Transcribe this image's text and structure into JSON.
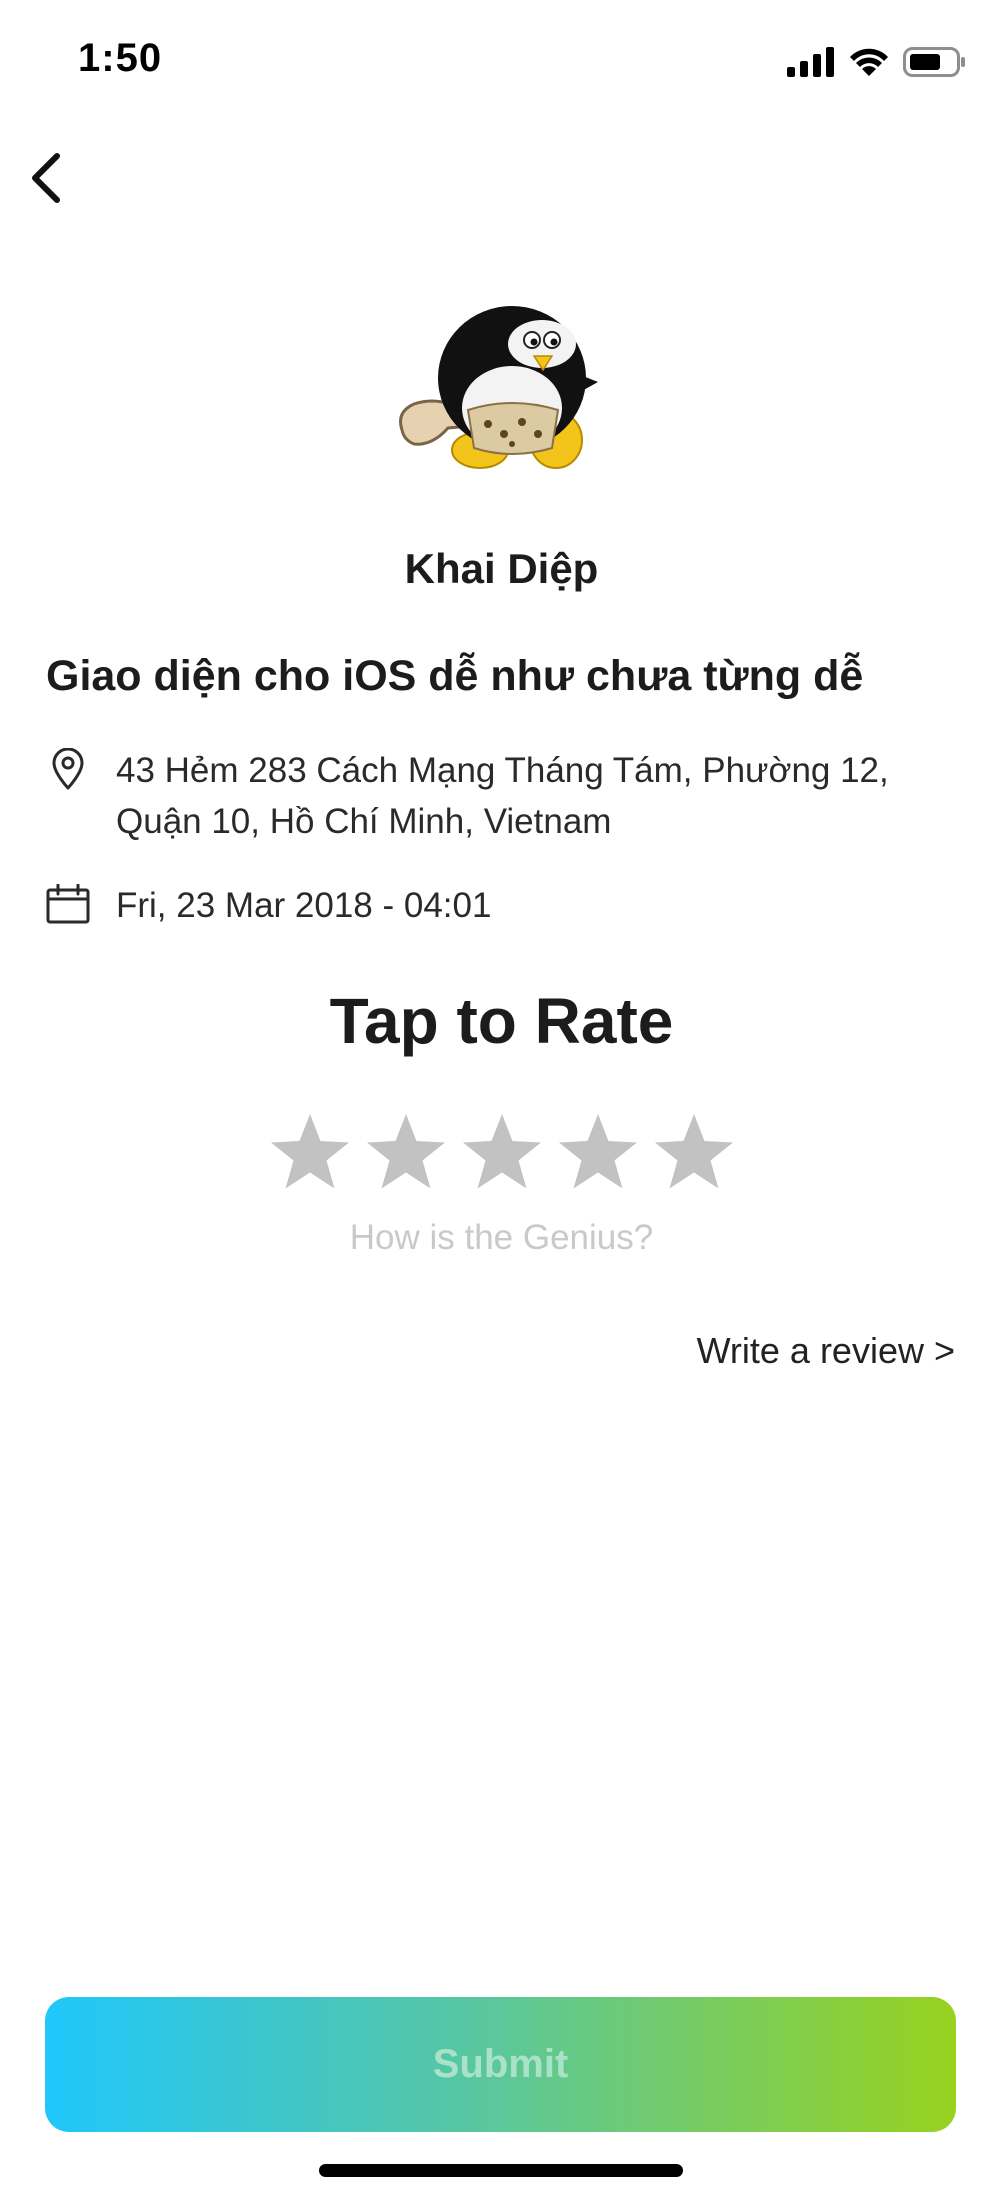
{
  "status_bar": {
    "time": "1:50",
    "icons": [
      "cellular-signal-icon",
      "wifi-icon",
      "battery-icon"
    ]
  },
  "nav": {
    "back_icon": "chevron-left-icon"
  },
  "profile": {
    "name": "Khai Diệp",
    "avatar": "penguin-avatar"
  },
  "event": {
    "title": "Giao diện cho iOS dễ như chưa từng dễ",
    "address_line1": "43 Hẻm 283 Cách Mạng Tháng Tám, Phường 12,",
    "address_line2": "Quận 10, Hồ Chí Minh, Vietnam",
    "address_icon": "location-pin-icon",
    "datetime": "Fri, 23 Mar 2018 - 04:01",
    "datetime_icon": "calendar-icon"
  },
  "rating": {
    "heading": "Tap to Rate",
    "hint": "How is the Genius?",
    "max_stars": 5,
    "selected": 0,
    "star_color_inactive": "#c2c2c2"
  },
  "review_link": "Write a review >",
  "submit": {
    "label": "Submit",
    "gradient": [
      "#1fc7fb",
      "#98d21e"
    ]
  }
}
